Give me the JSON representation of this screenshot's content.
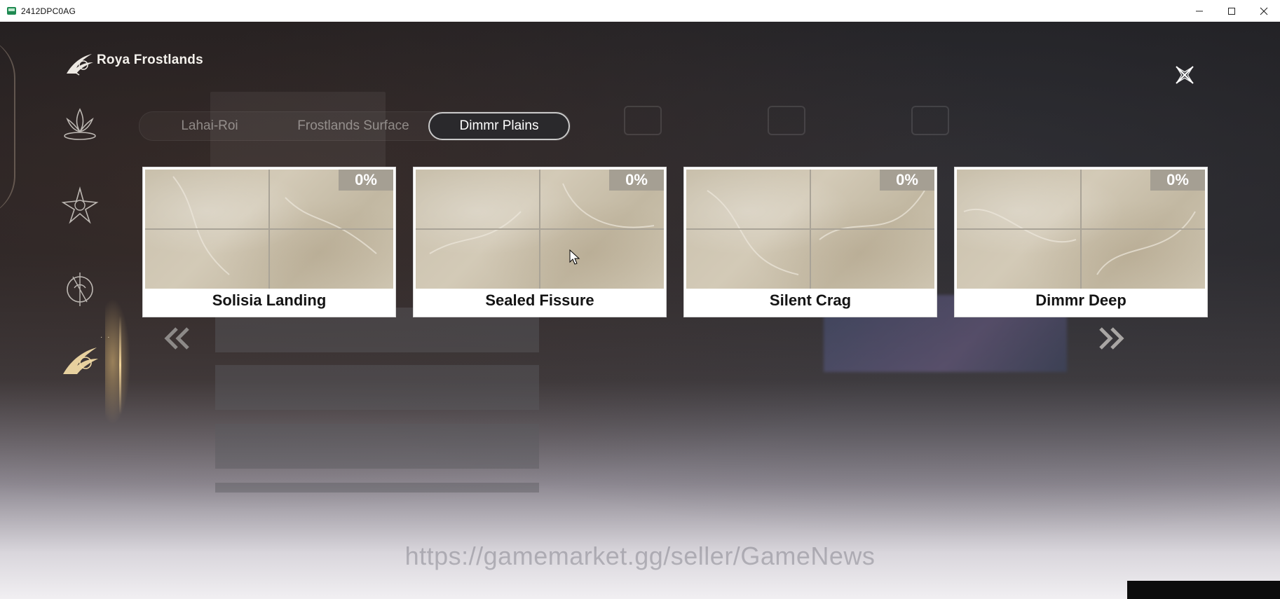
{
  "window": {
    "title": "2412DPC0AG",
    "controls": [
      "minimize-icon",
      "maximize-icon",
      "close-icon"
    ]
  },
  "header": {
    "region_title": "Roya Frostlands",
    "logo_icon": "roya-frostlands-emblem-icon",
    "close_icon": "star-close-icon"
  },
  "sidebar": {
    "items": [
      {
        "icon": "lotus-emblem-icon",
        "active": false
      },
      {
        "icon": "star-compass-icon",
        "active": false
      },
      {
        "icon": "crest-emblem-icon",
        "active": false
      },
      {
        "icon": "roya-frostlands-emblem-icon",
        "active": true
      }
    ]
  },
  "tabs": [
    {
      "label": "Lahai-Roi",
      "active": false
    },
    {
      "label": "Frostlands Surface",
      "active": false
    },
    {
      "label": "Dimmr Plains",
      "active": true
    }
  ],
  "areas": [
    {
      "name": "Solisia Landing",
      "progress": "0%"
    },
    {
      "name": "Sealed Fissure",
      "progress": "0%"
    },
    {
      "name": "Silent Crag",
      "progress": "0%"
    },
    {
      "name": "Dimmr Deep",
      "progress": "0%"
    }
  ],
  "navigation": {
    "prev_icon": "double-chevron-left-icon",
    "next_icon": "double-chevron-right-icon"
  },
  "overlay": {
    "watermark": "https://gamemarket.gg/seller/GameNews"
  },
  "colors": {
    "card_bg": "#ffffff",
    "badge_bg": "#a59f93",
    "active_tab_border": "#c9c9c9",
    "accent_gold": "#f2d49a"
  }
}
